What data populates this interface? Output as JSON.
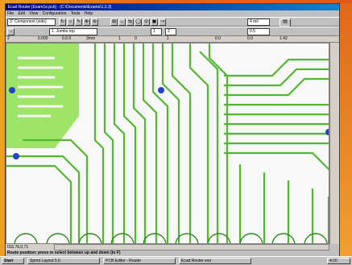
{
  "window": {
    "title": "Ecad Router [Exam1e.pcb] - (C:\\Documents\\Exams\\1.2.3)",
    "menu": [
      "File",
      "Edit",
      "View",
      "Configuration",
      "Tools",
      "Help"
    ]
  },
  "toolbar1": {
    "layer_select": "3\" Component (side)",
    "toolbar_glyphs": [
      "↻",
      "⌂",
      "✎",
      "⊕",
      "⊖",
      "⊞",
      "↔",
      "⇆",
      "◯",
      "⊙",
      "▣",
      "⇢"
    ],
    "value_box": "4 mil",
    "right_box": "▤"
  },
  "toolbar2": {
    "net_select": "1. Jumbo top",
    "value_boxes": [
      "1",
      "2",
      "0.5"
    ]
  },
  "ruler_row": [
    "2",
    "0.000",
    "0.0.0",
    "3mm",
    "1",
    "0",
    "1",
    "0.0",
    "0.0",
    "1.42"
  ],
  "status": {
    "left_readout": "ISS.76,0,71",
    "message": "Route position: press to select between up and down (to F)"
  },
  "taskbar": {
    "start_label": "Start",
    "items": [
      "Sprint Layout 5.0",
      "PCB Editor - Router",
      "Ecad Router exe"
    ],
    "clock": "4:20"
  },
  "colors": {
    "trace": "#52b832",
    "trace_dark": "#2e8a1c",
    "via": "#2244cc",
    "copper_fill": "#8ee050",
    "background": "#f8f8f8"
  }
}
